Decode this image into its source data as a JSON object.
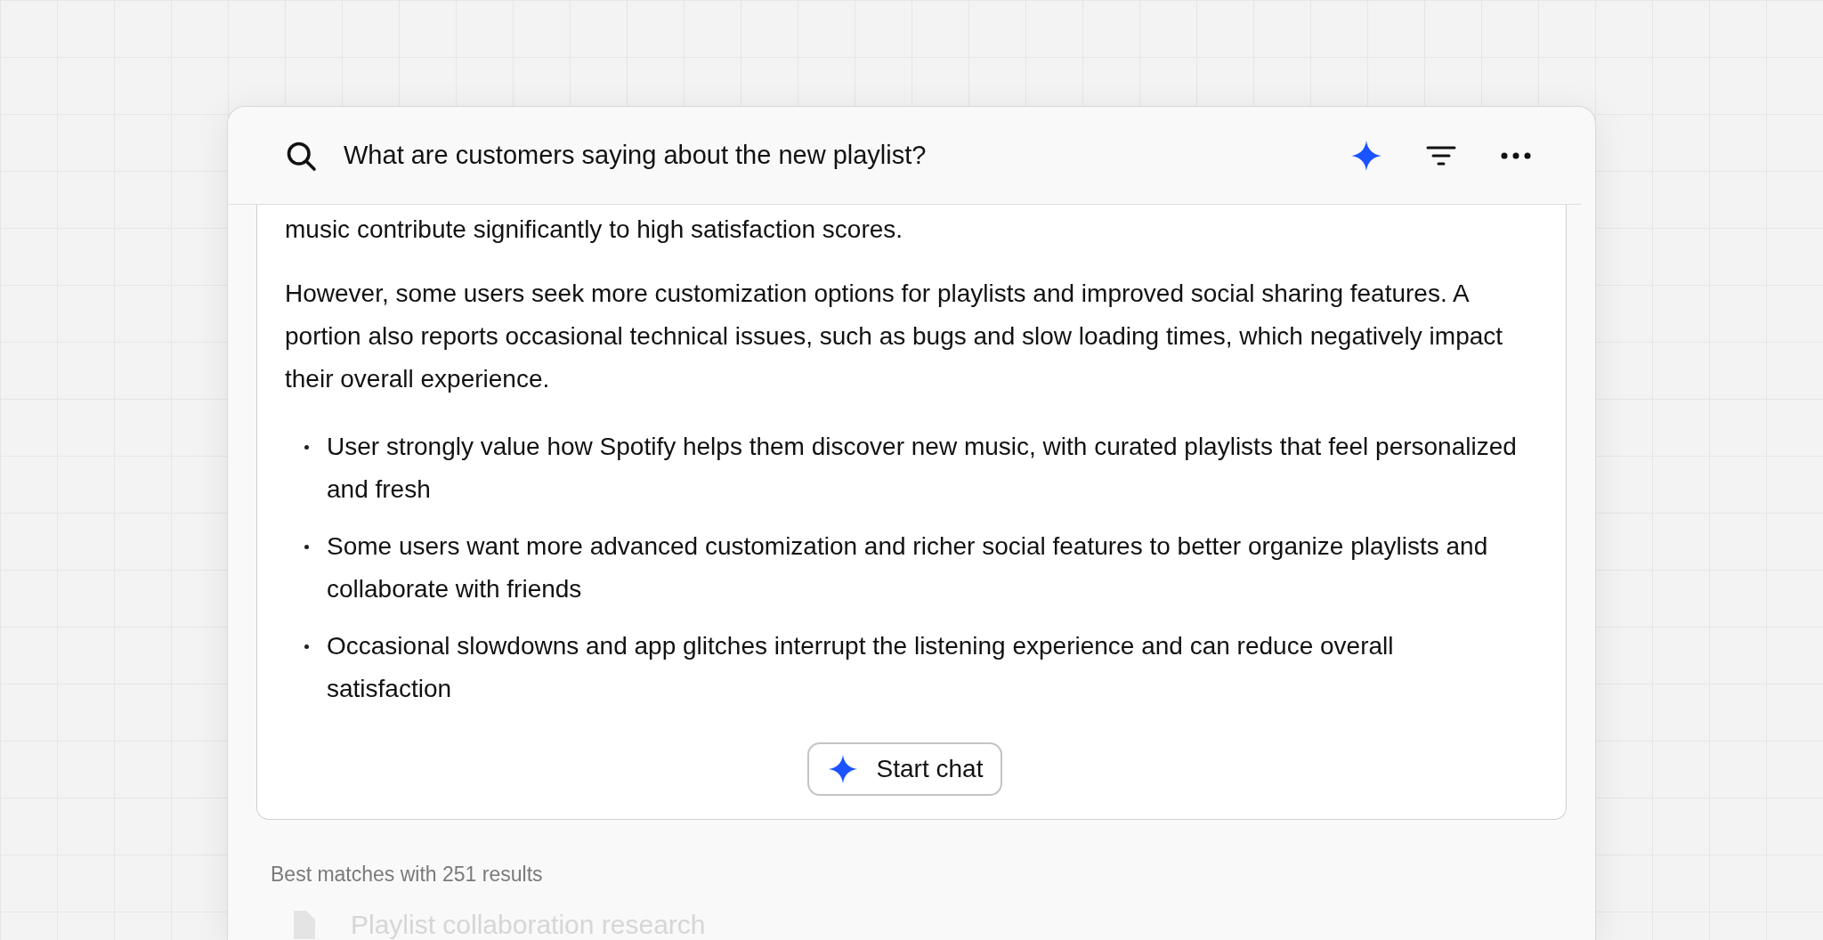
{
  "search": {
    "value": "What are customers saying about the new playlist?"
  },
  "answer": {
    "paragraphs": [
      "music contribute significantly to high satisfaction scores.",
      "However, some users seek more customization options for playlists and improved social sharing features. A portion also reports occasional technical issues, such as bugs and slow loading times, which negatively impact their overall experience."
    ],
    "bullets": [
      "User strongly value how Spotify helps them discover new music, with curated playlists that feel personalized and fresh",
      "Some users want more advanced customization and richer social features to better organize playlists and collaborate with friends",
      "Occasional slowdowns and app glitches interrupt the listening experience and can reduce overall satisfaction"
    ],
    "button": "Start chat"
  },
  "results": {
    "summary": "Best matches with 251 results",
    "items": [
      {
        "title": "Playlist collaboration research"
      }
    ]
  }
}
